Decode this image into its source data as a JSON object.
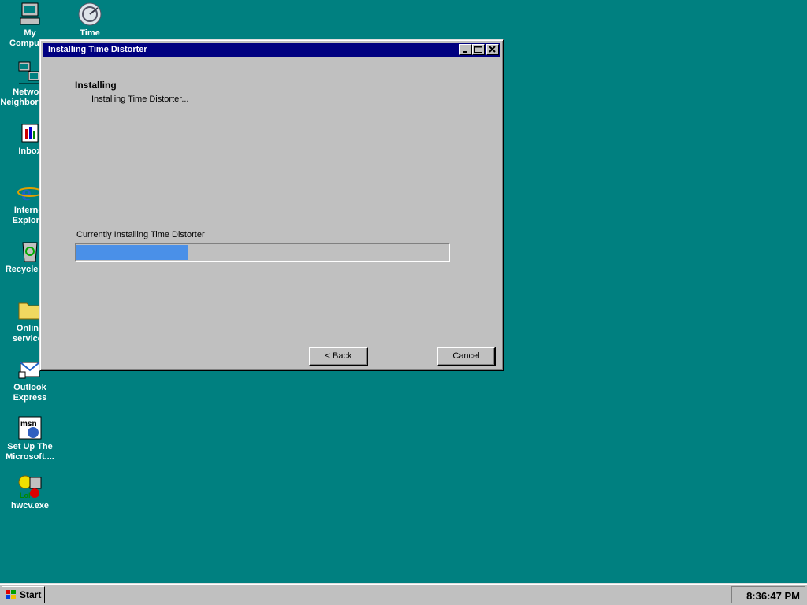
{
  "desktop": {
    "icons": [
      {
        "label": "My\nComputer",
        "icon": "my-computer-icon"
      },
      {
        "label": "Time",
        "icon": "time-distorter-icon"
      },
      {
        "label": "Network\nNeighborhood",
        "icon": "network-neighborhood-icon"
      },
      {
        "label": "Inbox",
        "icon": "inbox-icon"
      },
      {
        "label": "Internet\nExplorer",
        "icon": "internet-explorer-icon"
      },
      {
        "label": "Recycle Bin",
        "icon": "recycle-bin-icon"
      },
      {
        "label": "Online\nservices",
        "icon": "folder-icon"
      },
      {
        "label": "Outlook\nExpress",
        "icon": "outlook-express-icon"
      },
      {
        "label": "Set Up The\nMicrosoft....",
        "icon": "msn-setup-icon"
      },
      {
        "label": "hwcv.exe",
        "icon": "hwcv-exe-icon"
      }
    ]
  },
  "window": {
    "title": "Installing Time Distorter",
    "heading": "Installing",
    "subheading": "Installing Time Distorter...",
    "progress_label": "Currently Installing Time Distorter",
    "progress_fraction": 0.3,
    "back_label": "< Back",
    "cancel_label": "Cancel",
    "controls": {
      "minimize": "minimize-icon",
      "maximize": "maximize-icon",
      "close": "close-icon"
    }
  },
  "taskbar": {
    "start_label": "Start",
    "clock": "8:36:47 PM"
  },
  "colors": {
    "desktop": "#008080",
    "titlebar": "#000080",
    "progress": "#4a90e8",
    "face": "#c0c0c0"
  }
}
